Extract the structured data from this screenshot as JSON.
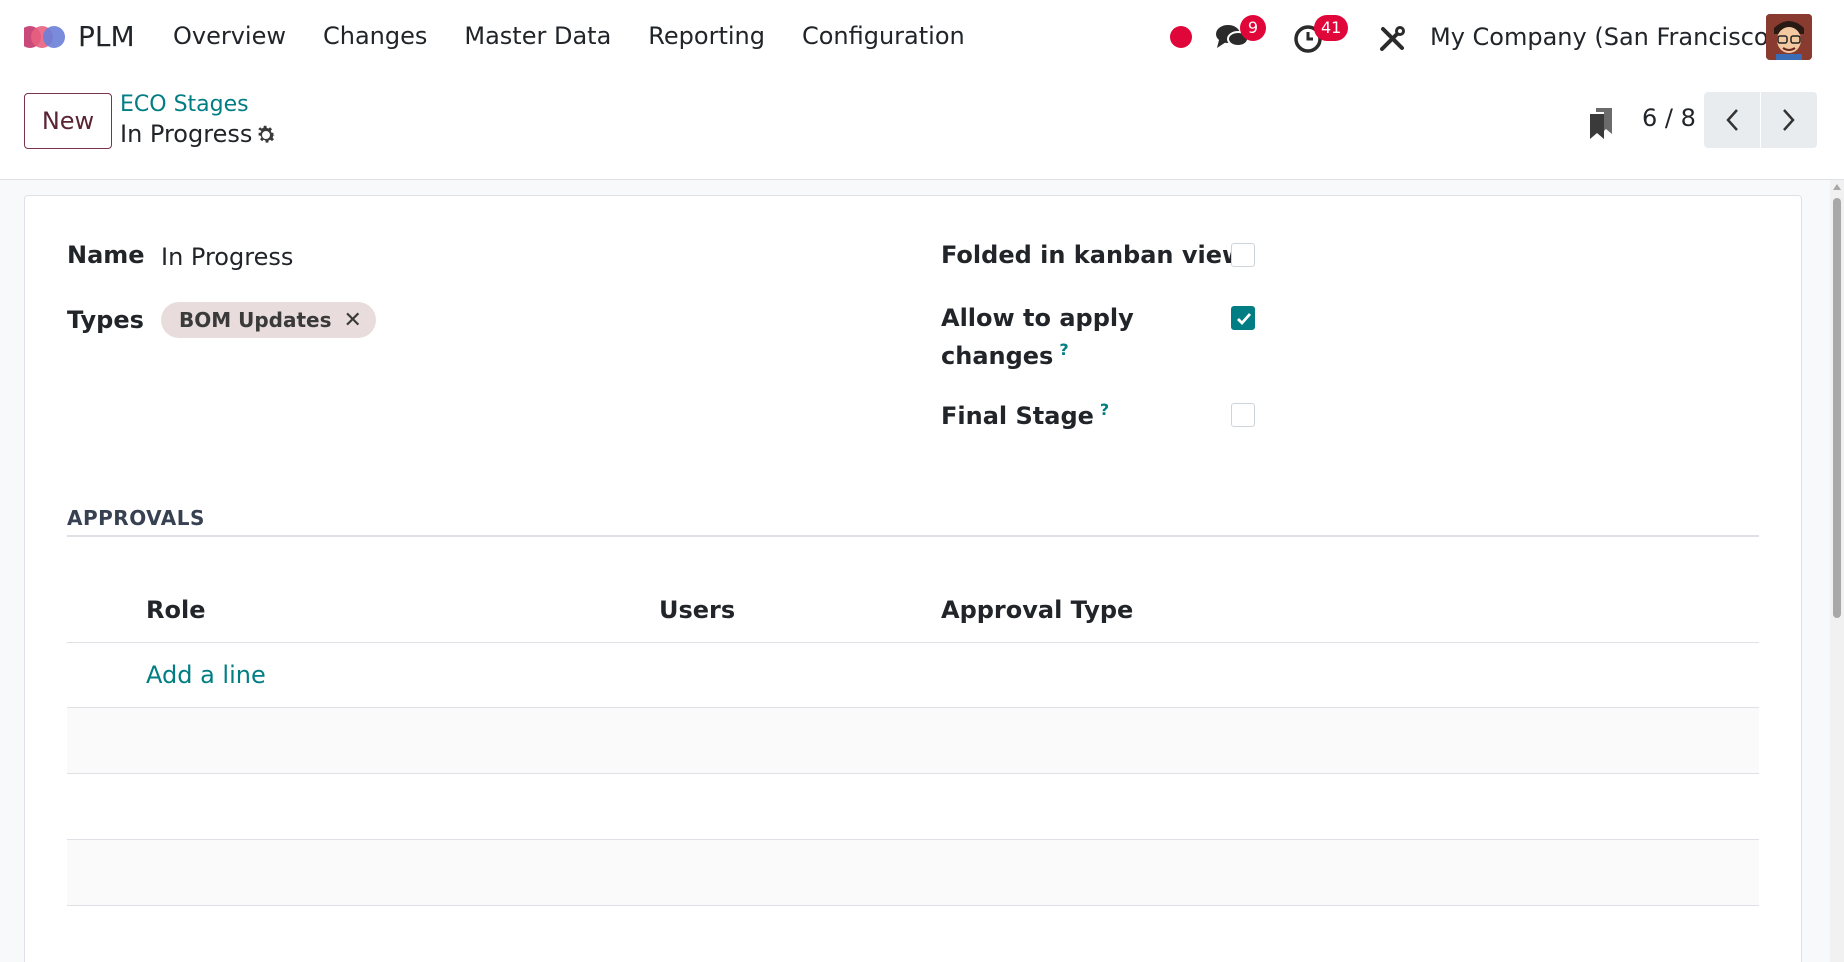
{
  "navbar": {
    "app_name": "PLM",
    "menu": [
      {
        "label": "Overview"
      },
      {
        "label": "Changes"
      },
      {
        "label": "Master Data"
      },
      {
        "label": "Reporting"
      },
      {
        "label": "Configuration"
      }
    ],
    "messages_badge": "9",
    "activities_badge": "41",
    "company": "My Company (San Francisco)",
    "icons": [
      "app-logo-icon",
      "recording-dot-icon",
      "chat-icon",
      "activity-clock-icon",
      "debug-tools-icon",
      "user-avatar"
    ]
  },
  "control_panel": {
    "new_label": "New",
    "breadcrumb_parent": "ECO Stages",
    "breadcrumb_current": "In Progress",
    "pager_value": "6 / 8"
  },
  "form": {
    "name_label": "Name",
    "name_value": "In Progress",
    "types_label": "Types",
    "types_tags": [
      {
        "label": "BOM Updates"
      }
    ],
    "folded_label": "Folded in kanban view",
    "folded_checked": false,
    "allow_apply_label_line1": "Allow to apply",
    "allow_apply_label_line2": "changes",
    "allow_apply_checked": true,
    "final_stage_label": "Final Stage",
    "final_stage_checked": false,
    "help_mark": "?"
  },
  "approvals": {
    "section_title": "APPROVALS",
    "columns": [
      "Role",
      "Users",
      "Approval Type"
    ],
    "add_line_label": "Add a line",
    "rows": []
  },
  "colors": {
    "accent": "#017e84",
    "badge": "#e0063a",
    "new_button_border": "#7a3348",
    "tag_bg": "#e8dcdc"
  }
}
